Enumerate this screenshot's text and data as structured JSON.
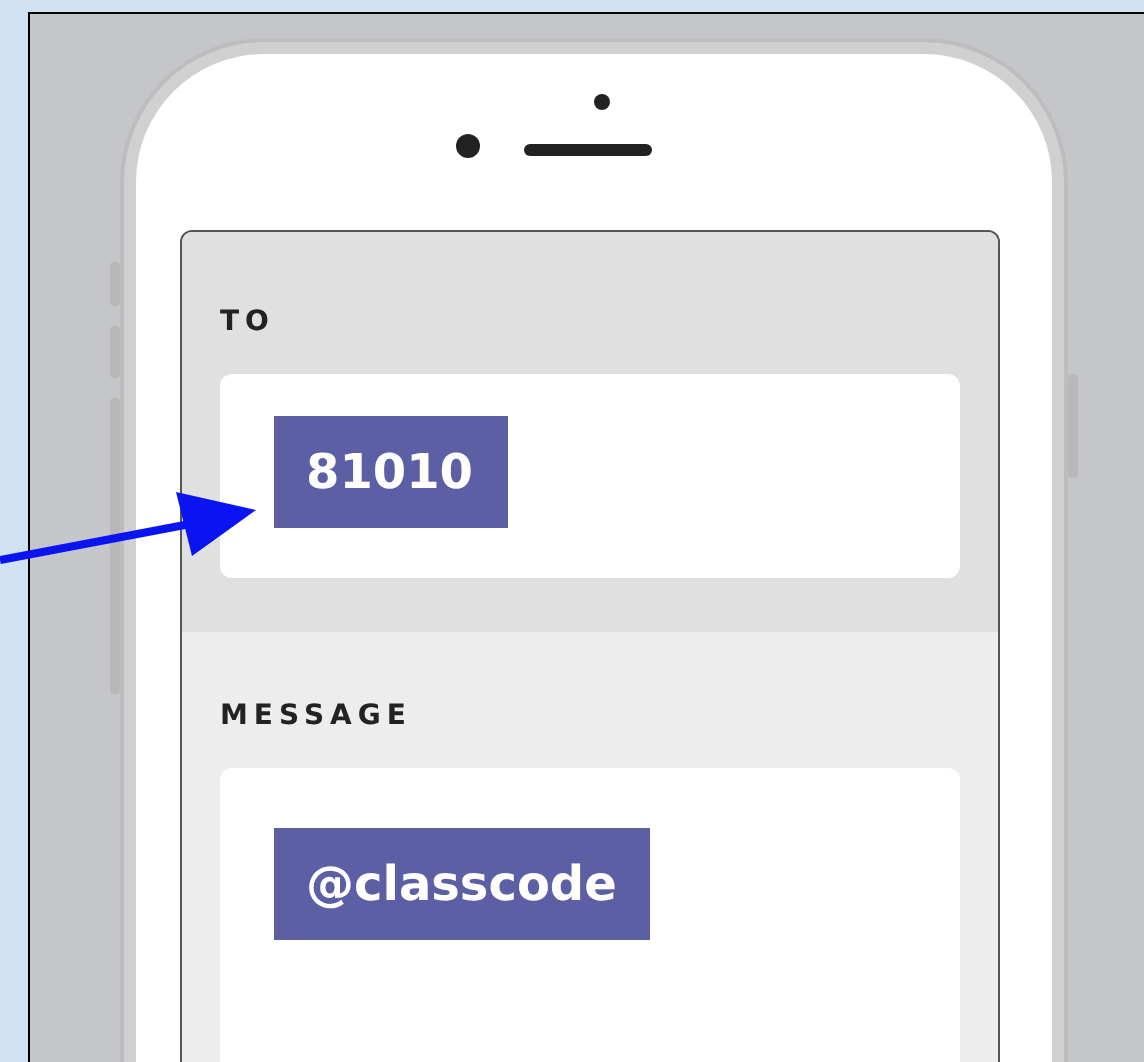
{
  "sections": [
    {
      "kind": "to",
      "label": "TO",
      "value": "81010"
    },
    {
      "kind": "message",
      "label": "MESSAGE",
      "value": "@classcode"
    }
  ]
}
